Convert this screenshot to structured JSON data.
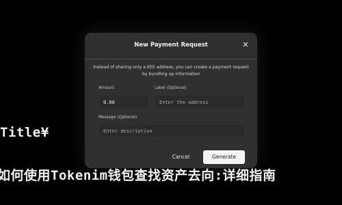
{
  "background": {
    "title_text": "Title¥",
    "heading_text": "如何使用Tokenim钱包查找资产去向:详细指南"
  },
  "dialog": {
    "title": "New Payment Request",
    "description": "Instead of sharing only a KEE address, you can create a payment request by bundling up information",
    "fields": {
      "amount": {
        "label": "Amount",
        "value": "0.00"
      },
      "label": {
        "label": "Label (Optional)",
        "placeholder": "Enter the address"
      },
      "message": {
        "label": "Message (Optional)",
        "placeholder": "Enter description"
      }
    },
    "buttons": {
      "cancel": "Cancel",
      "generate": "Generate"
    },
    "close_icon": "close-icon"
  },
  "colors": {
    "background": "#000000",
    "panel": "#3c3c3c",
    "generate_button": "#f4f4f4"
  }
}
